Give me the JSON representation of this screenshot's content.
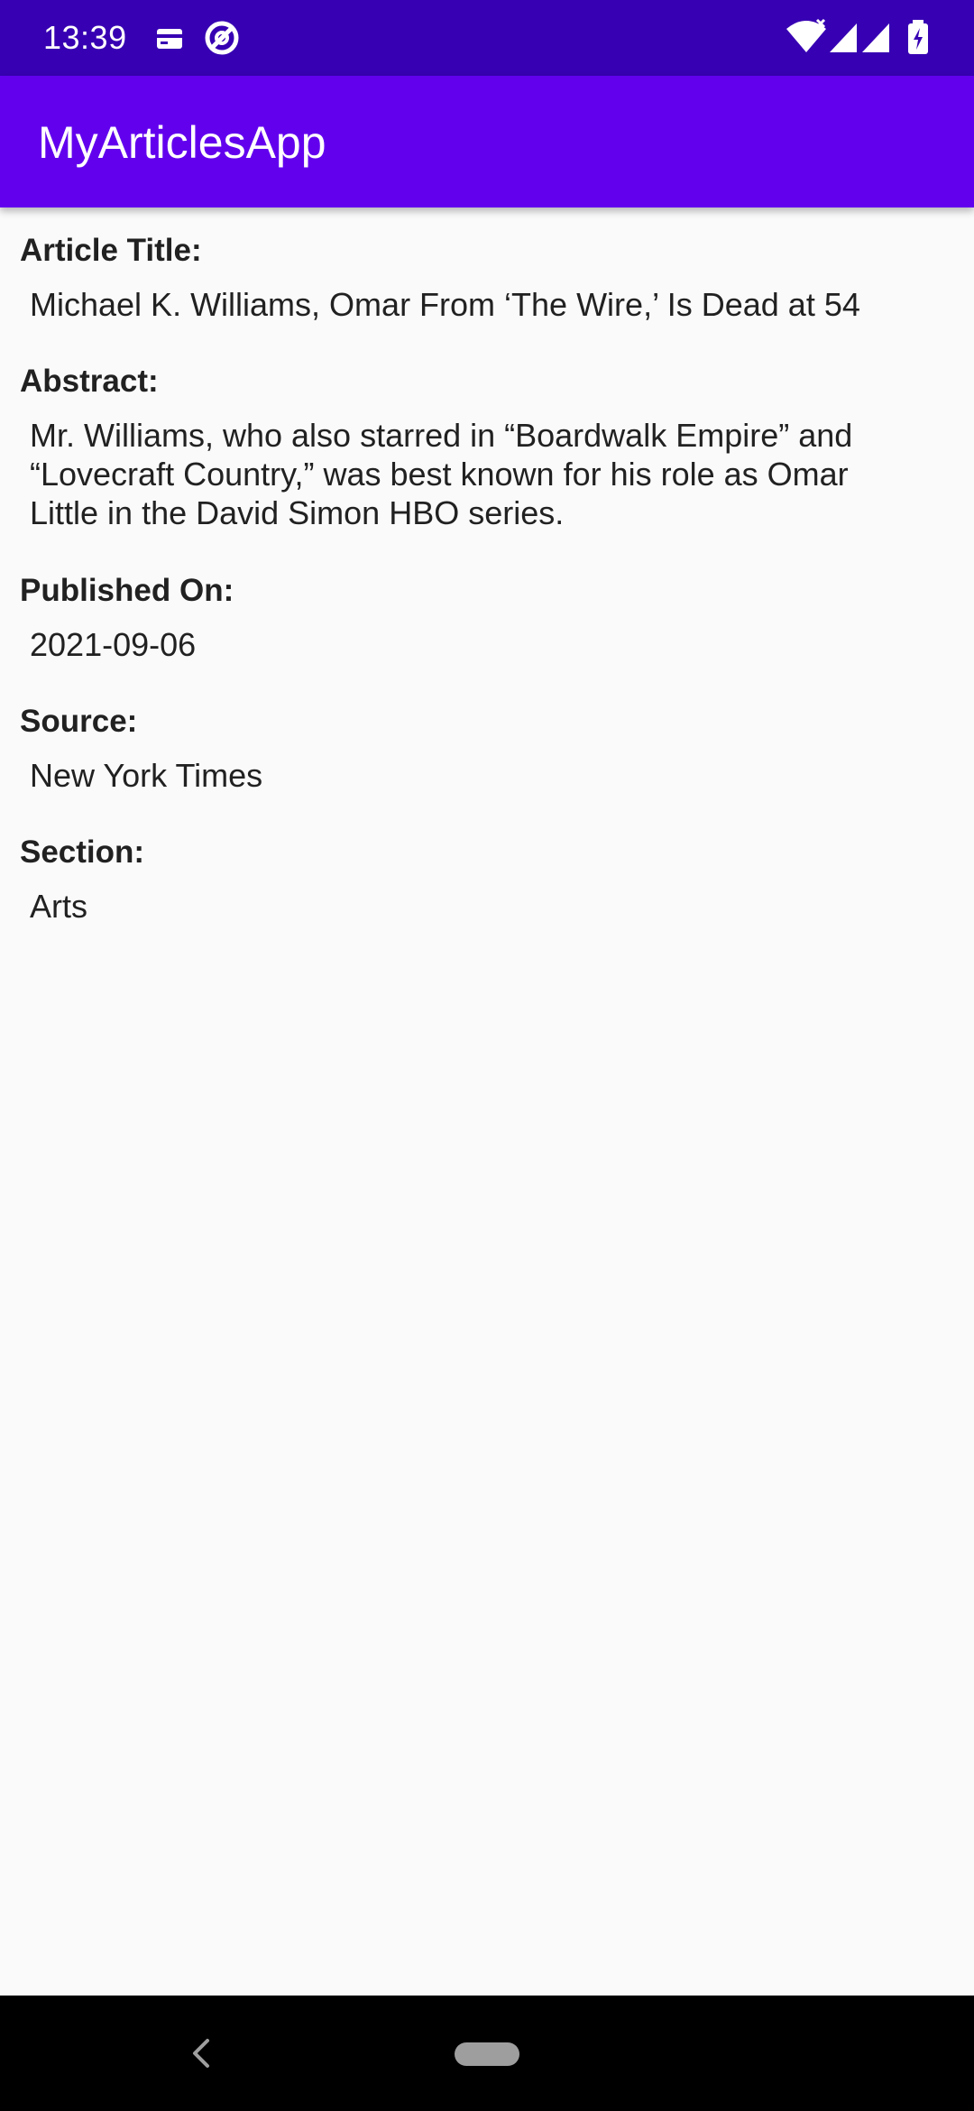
{
  "status_bar": {
    "time": "13:39",
    "left_icons": [
      "sim-card-icon",
      "data-saver-icon"
    ],
    "right_icons": [
      "wifi-icon",
      "signal-icon",
      "battery-icon"
    ]
  },
  "app_bar": {
    "title": "MyArticlesApp"
  },
  "article": {
    "title_label": "Article Title:",
    "title": "Michael K. Williams, Omar From ‘The Wire,’ Is Dead at 54",
    "abstract_label": "Abstract:",
    "abstract": "Mr. Williams, who also starred in “Boardwalk Empire” and “Lovecraft Country,” was best known for his role as Omar Little in the David Simon HBO series.",
    "published_label": "Published On:",
    "published": "2021-09-06",
    "source_label": "Source:",
    "source": "New York Times",
    "section_label": "Section:",
    "section": "Arts"
  },
  "nav_bar": {
    "icons": [
      "back-icon",
      "home-pill-icon"
    ]
  },
  "colors": {
    "status_bar": "#3700b3",
    "app_bar": "#6200ee",
    "background": "#fafafa",
    "text": "#212121",
    "nav_bar": "#000000"
  }
}
